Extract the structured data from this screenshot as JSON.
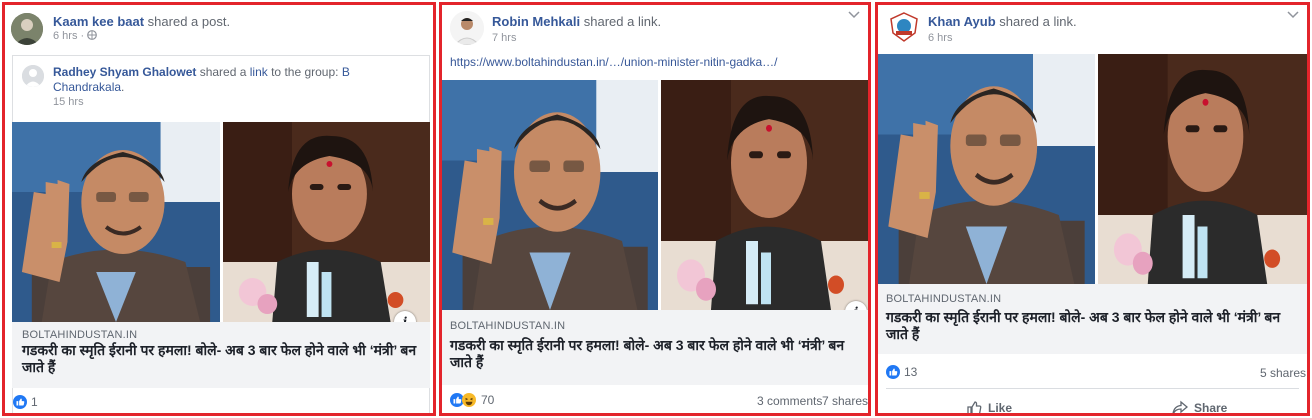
{
  "posts": [
    {
      "author": "Kaam kee baat",
      "action": " shared a post.",
      "time": "6 hrs · ",
      "shared": {
        "author": "Radhey Shyam Ghalowet",
        "text1": " shared a ",
        "link_word": "link",
        "text2": " to the group: ",
        "group1": "B",
        "group2": "Chandrakala",
        "period": ".",
        "time": "15 hrs"
      },
      "domain": "BOLTAHINDUSTAN.IN",
      "headline": "गडकरी का स्मृति ईरानी पर हमला! बोले- अब 3 बार फेल होने वाले भी ‘मंत्री’ बन जाते हैं",
      "reactions": "1"
    },
    {
      "author": "Robin Mehkali",
      "action": " shared a link.",
      "time": "7 hrs",
      "url": "https://www.boltahindustan.in/…/union-minister-nitin-gadka…/",
      "domain": "BOLTAHINDUSTAN.IN",
      "headline": "गडकरी का स्मृति ईरानी पर हमला! बोले- अब 3 बार फेल होने वाले भी ‘मंत्री’ बन जाते हैं",
      "reactions": "70",
      "comments": "3 comments",
      "shares": "7 shares"
    },
    {
      "author": "Khan Ayub",
      "action": " shared a link.",
      "time": "6 hrs",
      "domain": "BOLTAHINDUSTAN.IN",
      "headline": "गडकरी का स्मृति ईरानी पर हमला! बोले- अब 3 बार फेल होने वाले भी ‘मंत्री’ बन जाते हैं",
      "reactions": "13",
      "shares": "5 shares",
      "like_label": "Like",
      "share_label": "Share"
    }
  ],
  "info_icon": "i",
  "icons": [
    "globe-icon",
    "chevron-down-icon",
    "like-reaction-icon",
    "haha-reaction-icon",
    "info-icon",
    "like-icon",
    "share-icon"
  ],
  "colors": {
    "border": "#e3242b",
    "link": "#365899",
    "like": "#2078f4",
    "haha": "#f7b928"
  }
}
